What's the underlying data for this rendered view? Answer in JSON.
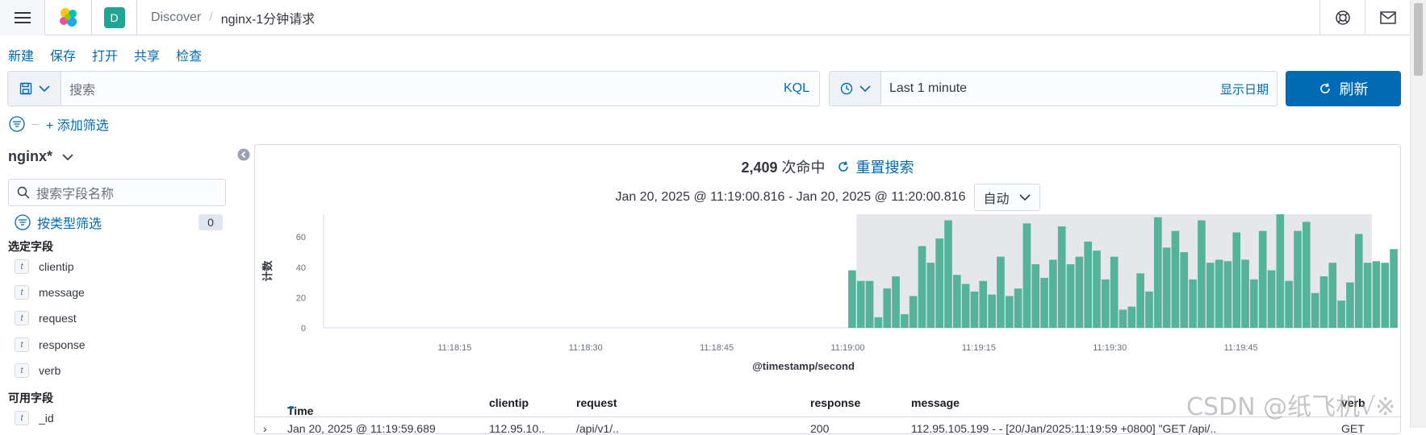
{
  "breadcrumbs": {
    "app": "Discover",
    "page": "nginx-1分钟请求"
  },
  "space_initial": "D",
  "top_actions": [
    "新建",
    "保存",
    "打开",
    "共享",
    "检查"
  ],
  "query": {
    "placeholder": "搜索",
    "language": "KQL"
  },
  "time": {
    "range": "Last 1 minute",
    "show_dates": "显示日期",
    "refresh": "刷新"
  },
  "filters": {
    "add_label": "+ 添加筛选"
  },
  "sidebar": {
    "index_pattern": "nginx*",
    "field_search_placeholder": "搜索字段名称",
    "type_filter_label": "按类型筛选",
    "type_filter_count": "0",
    "selected_title": "选定字段",
    "selected_fields": [
      {
        "type": "t",
        "name": "clientip"
      },
      {
        "type": "t",
        "name": "message"
      },
      {
        "type": "t",
        "name": "request"
      },
      {
        "type": "t",
        "name": "response"
      },
      {
        "type": "t",
        "name": "verb"
      }
    ],
    "available_title": "可用字段",
    "available_fields": [
      {
        "type": "t",
        "name": "_id"
      }
    ]
  },
  "results": {
    "hit_count": "2,409",
    "hits_label": "次命中",
    "reset_label": "重置搜索",
    "time_range": "Jan 20, 2025 @ 11:19:00.816 - Jan 20, 2025 @ 11:20:00.816",
    "interval": "自动"
  },
  "chart_data": {
    "type": "bar",
    "ylabel": "计数",
    "xlabel": "@timestamp/second",
    "ylim": [
      0,
      75
    ],
    "yticks": [
      0,
      20,
      40,
      60
    ],
    "x_start": "11:18:00",
    "x_end": "11:20:00",
    "x_ticks": [
      "11:18:15",
      "11:18:30",
      "11:18:45",
      "11:19:00",
      "11:19:15",
      "11:19:30",
      "11:19:45"
    ],
    "highlight_start": "11:19:01",
    "highlight_end": "11:20:00",
    "bar_start": "11:19:01",
    "bar_step_seconds": 1,
    "values": [
      38,
      31,
      31,
      7,
      26,
      34,
      9,
      21,
      54,
      43,
      59,
      71,
      35,
      29,
      24,
      31,
      22,
      47,
      21,
      26,
      69,
      42,
      33,
      45,
      67,
      42,
      47,
      57,
      51,
      32,
      47,
      12,
      14,
      36,
      24,
      73,
      53,
      64,
      50,
      32,
      71,
      43,
      45,
      44,
      63,
      45,
      32,
      64,
      38,
      75,
      31,
      64,
      70,
      23,
      34,
      43,
      18,
      30,
      62,
      43,
      44,
      43,
      52
    ],
    "bar_color": "#54b399",
    "highlight_color": "#e6e7ea"
  },
  "table": {
    "columns": [
      "Time",
      "clientip",
      "request",
      "response",
      "message",
      "verb"
    ],
    "first_row": [
      "Jan 20, 2025 @ 11:19:59.689",
      "112.95.10..",
      "/api/v1/..",
      "200",
      "112.95.105.199 - - [20/Jan/2025:11:19:59 +0800] \"GET /api/..",
      "GET"
    ]
  },
  "watermark": "CSDN @纸飞机√※"
}
